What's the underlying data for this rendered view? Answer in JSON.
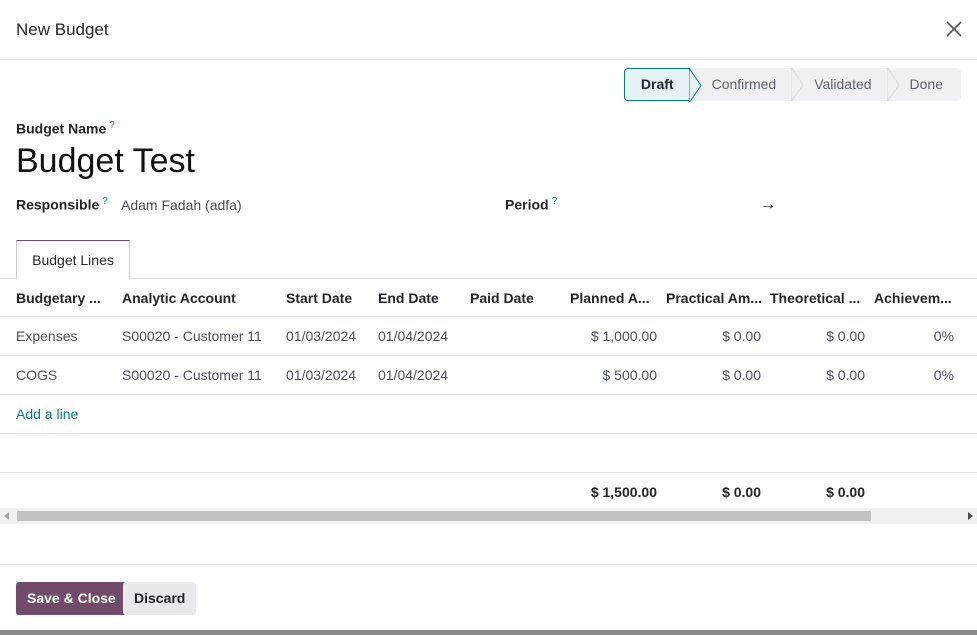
{
  "dialog": {
    "title": "New Budget"
  },
  "status": {
    "stages": [
      "Draft",
      "Confirmed",
      "Validated",
      "Done"
    ],
    "active": "Draft"
  },
  "form": {
    "budget_name_label": "Budget Name",
    "budget_name_value": "Budget Test",
    "responsible_label": "Responsible",
    "responsible_value": "Adam Fadah (adfa)",
    "period_label": "Period",
    "period_arrow": "→",
    "help_marker": "?"
  },
  "tabs": [
    "Budget Lines"
  ],
  "table": {
    "columns": [
      "Budgetary ...",
      "Analytic Account",
      "Start Date",
      "End Date",
      "Paid Date",
      "Planned A...",
      "Practical Am...",
      "Theoretical ...",
      "Achievem..."
    ],
    "rows": [
      {
        "budgetary": "Expenses",
        "analytic": "S00020 - Customer 11",
        "start": "01/03/2024",
        "end": "01/04/2024",
        "paid": "",
        "planned": "$ 1,000.00",
        "practical": "$ 0.00",
        "theoretical": "$ 0.00",
        "achievement": "0%"
      },
      {
        "budgetary": "COGS",
        "analytic": "S00020 - Customer 11",
        "start": "01/03/2024",
        "end": "01/04/2024",
        "paid": "",
        "planned": "$ 500.00",
        "practical": "$ 0.00",
        "theoretical": "$ 0.00",
        "achievement": "0%"
      }
    ],
    "add_line": "Add a line",
    "totals": {
      "planned": "$ 1,500.00",
      "practical": "$ 0.00",
      "theoretical": "$ 0.00"
    }
  },
  "footer": {
    "save_label": "Save & Close",
    "discard_label": "Discard"
  },
  "colors": {
    "brand": "#714b67",
    "accent": "#017e84"
  },
  "icons": {
    "close": "close-icon",
    "arrow": "arrow-right-icon"
  }
}
